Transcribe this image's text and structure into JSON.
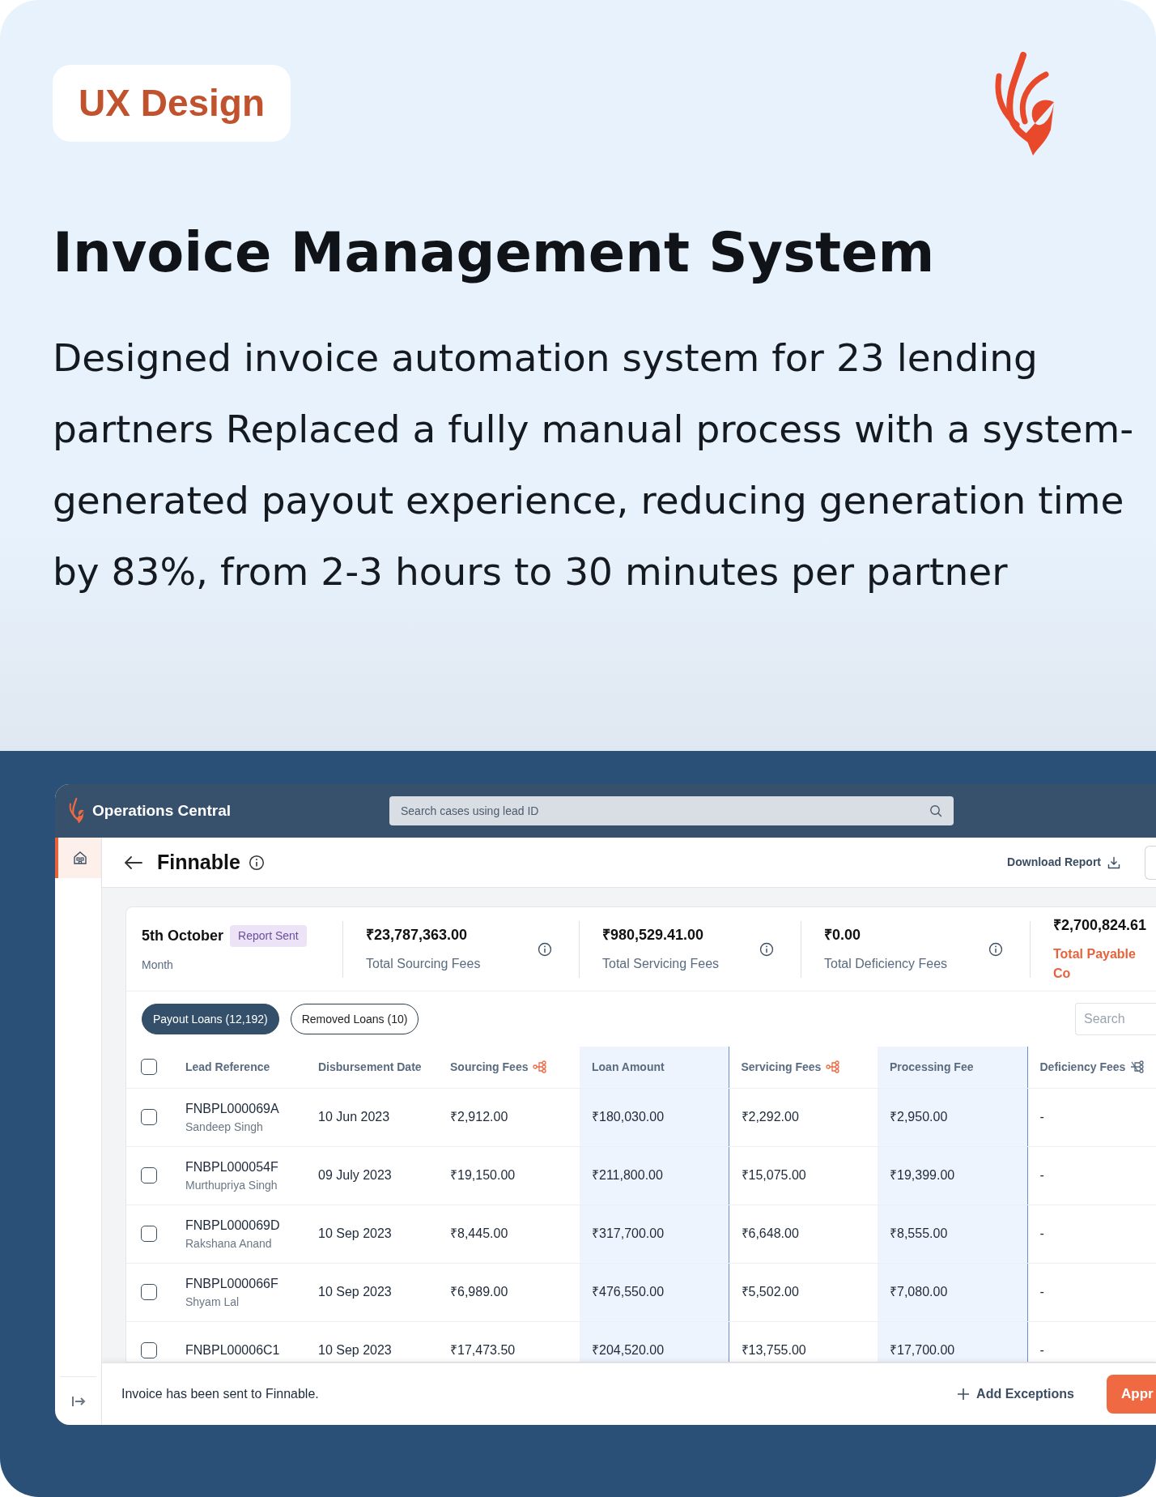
{
  "badge": "UX Design",
  "title": "Invoice Management System",
  "description": "Designed invoice automation system for 23 lending partners Replaced a fully manual process with a system-generated payout experience, reducing generation time by 83%, from 2-3 hours to 30 minutes per partner",
  "app": {
    "brand": "Operations Central",
    "search": {
      "placeholder": "Search cases using lead ID"
    },
    "sidebar_items": [
      {
        "kind": "home",
        "selected": true
      }
    ],
    "page_title": "Finnable",
    "download": "Download Report",
    "period": {
      "value": "5th October",
      "status": "Report Sent",
      "label": "Month"
    },
    "stats": [
      {
        "value": "₹23,787,363.00",
        "label": "Total Sourcing Fees",
        "highlight": false,
        "info": true
      },
      {
        "value": "₹980,529.41.00",
        "label": "Total Servicing Fees",
        "highlight": false,
        "info": true
      },
      {
        "value": "₹0.00",
        "label": "Total Deficiency Fees",
        "highlight": false,
        "info": true
      },
      {
        "value": "₹2,700,824.61",
        "label": "Total Payable Co",
        "highlight": true,
        "info": false
      }
    ],
    "tabs": [
      {
        "label": "Payout Loans (12,192)",
        "selected": true
      },
      {
        "label": "Removed Loans (10)",
        "selected": false
      }
    ],
    "table_search": {
      "placeholder": "Search"
    },
    "table": {
      "all_checked": false,
      "columns": [
        {
          "label": "Lead Reference",
          "shaded": false
        },
        {
          "label": "Disbursement Date",
          "shaded": false
        },
        {
          "label": "Sourcing Fees",
          "shaded": false,
          "kind": "tree"
        },
        {
          "label": "Loan Amount",
          "shaded": true
        },
        {
          "label": "Servicing Fees",
          "shaded": false,
          "kind": "tree"
        },
        {
          "label": "Processing Fee",
          "shaded": true
        },
        {
          "label": "Deficiency Fees",
          "shaded": false,
          "kind": "split"
        }
      ],
      "rows": [
        {
          "checked": false,
          "name": "Sandeep Singh",
          "cells": [
            "FNBPL000069A",
            "10 Jun 2023",
            "₹2,912.00",
            "₹180,030.00",
            "₹2,292.00",
            "₹2,950.00",
            "-"
          ]
        },
        {
          "checked": false,
          "name": "Murthupriya Singh",
          "cells": [
            "FNBPL000054F",
            "09 July 2023",
            "₹19,150.00",
            "₹211,800.00",
            "₹15,075.00",
            "₹19,399.00",
            "-"
          ]
        },
        {
          "checked": false,
          "name": "Rakshana Anand",
          "cells": [
            "FNBPL000069D",
            "10 Sep 2023",
            "₹8,445.00",
            "₹317,700.00",
            "₹6,648.00",
            "₹8,555.00",
            "-"
          ]
        },
        {
          "checked": false,
          "name": "Shyam Lal",
          "cells": [
            "FNBPL000066F",
            "10 Sep 2023",
            "₹6,989.00",
            "₹476,550.00",
            "₹5,502.00",
            "₹7,080.00",
            "-"
          ]
        },
        {
          "checked": false,
          "cells": [
            "FNBPL00006C1",
            "10 Sep 2023",
            "₹17,473.50",
            "₹204,520.00",
            "₹13,755.00",
            "₹17,700.00",
            "-"
          ]
        }
      ]
    },
    "footer": {
      "message": "Invoice has been sent to Finnable.",
      "secondary": "Add Exceptions",
      "primary": "Appr"
    }
  }
}
